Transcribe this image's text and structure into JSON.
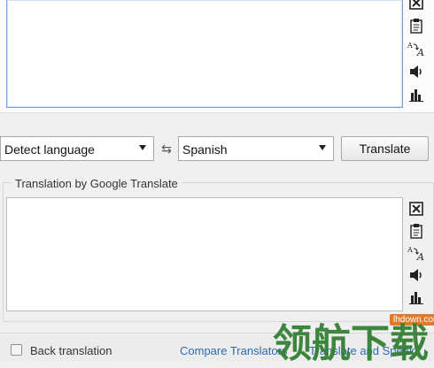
{
  "source": {
    "text": ""
  },
  "controls": {
    "from_language": "Detect language",
    "swap_glyph": "⇆",
    "to_language": "Spanish",
    "translate_label": "Translate"
  },
  "output": {
    "group_label": "Translation by Google Translate",
    "text": ""
  },
  "side_icons": [
    "close-icon",
    "paste-icon",
    "language-icon",
    "speaker-icon",
    "statistics-icon"
  ],
  "footer": {
    "back_translation_label": "Back translation",
    "compare_translators_label": "Compare Translators",
    "translate_and_speak_label": "Translate and Speak"
  },
  "watermark": {
    "url": "lhdown.com",
    "text": "领航下载"
  },
  "colors": {
    "accent_border": "#7aa2d6",
    "link": "#2b6cb0",
    "watermark": "#2f7d2f"
  }
}
